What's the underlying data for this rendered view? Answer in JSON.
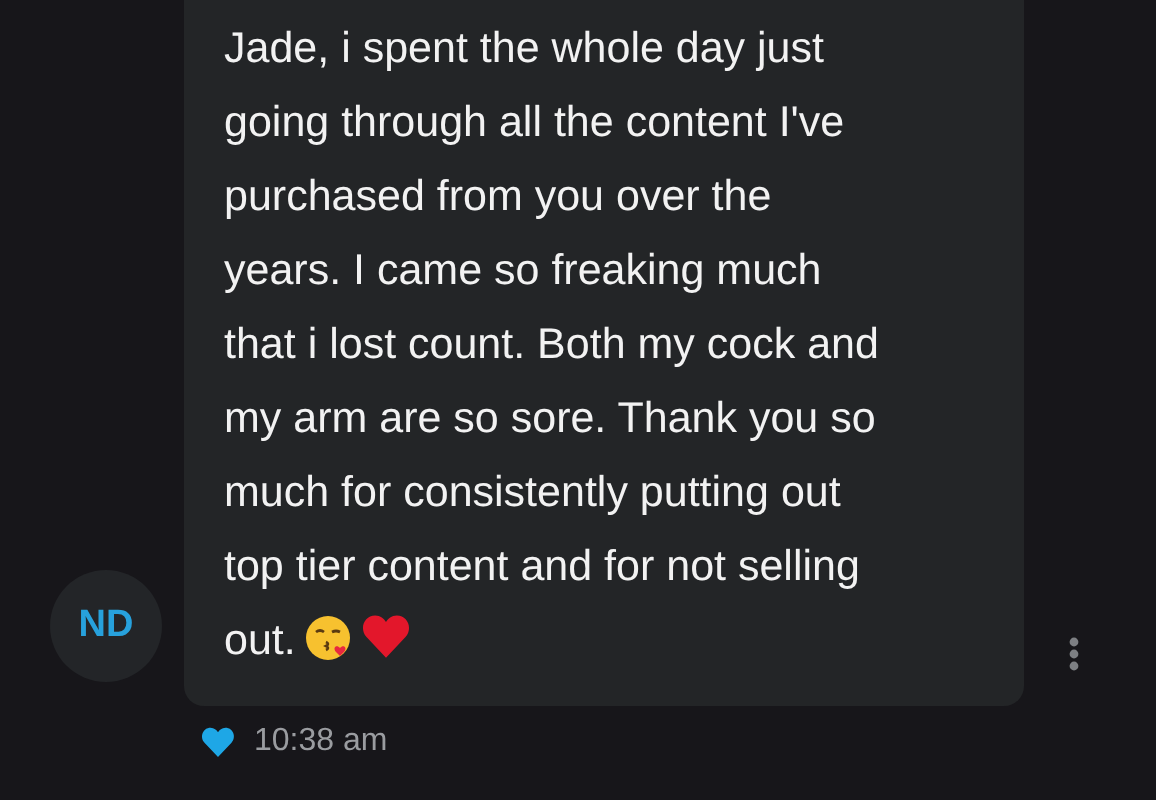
{
  "message": {
    "avatar_initials": "ND",
    "lines": [
      "Jade, i spent the whole day just",
      "going through all the content I've",
      "purchased from you over the",
      "years. I came so freaking much",
      "that i lost count. Both my cock and",
      "my arm are so sore. Thank you so",
      "much for consistently putting out",
      "top tier content and for not selling",
      "out."
    ],
    "time": "10:38 am"
  }
}
